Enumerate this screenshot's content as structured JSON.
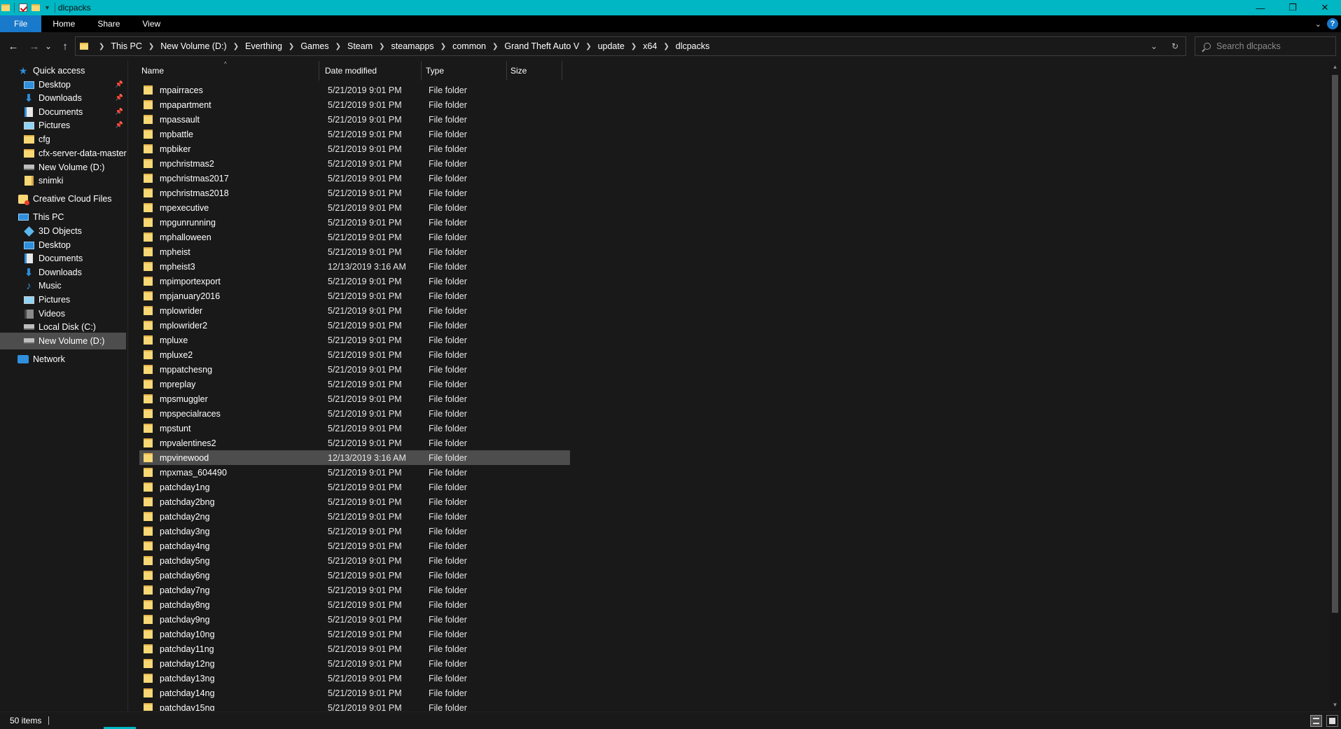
{
  "window": {
    "title": "dlcpacks",
    "controls": {
      "minimize": "—",
      "maximize": "❐",
      "close": "✕"
    }
  },
  "ribbon": {
    "tabs": [
      "File",
      "Home",
      "Share",
      "View"
    ],
    "help": "?"
  },
  "nav": {
    "back": "←",
    "forward": "→",
    "recent": "⌄",
    "up": "↑",
    "breadcrumbs": [
      "This PC",
      "New Volume (D:)",
      "Everthing",
      "Games",
      "Steam",
      "steamapps",
      "common",
      "Grand Theft Auto V",
      "update",
      "x64",
      "dlcpacks"
    ],
    "dropdown": "⌄",
    "refresh": "↻",
    "search_placeholder": "Search dlcpacks"
  },
  "sidebar": {
    "items": [
      {
        "label": "Quick access",
        "icon": "star-icon",
        "level": 0
      },
      {
        "label": "Desktop",
        "icon": "desktop-icon",
        "level": 1,
        "pinned": true
      },
      {
        "label": "Downloads",
        "icon": "download-icon",
        "level": 1,
        "pinned": true
      },
      {
        "label": "Documents",
        "icon": "document-icon",
        "level": 1,
        "pinned": true
      },
      {
        "label": "Pictures",
        "icon": "pictures-icon",
        "level": 1,
        "pinned": true
      },
      {
        "label": "cfg",
        "icon": "folder-icon",
        "level": 1
      },
      {
        "label": "cfx-server-data-master",
        "icon": "folder-icon",
        "level": 1
      },
      {
        "label": "New Volume (D:)",
        "icon": "drive-icon",
        "level": 1
      },
      {
        "label": "snimki",
        "icon": "folder-icon",
        "level": 1
      },
      {
        "label": "Creative Cloud Files",
        "icon": "creative-cloud-icon",
        "level": 0
      },
      {
        "label": "This PC",
        "icon": "computer-icon",
        "level": 0
      },
      {
        "label": "3D Objects",
        "icon": "3d-objects-icon",
        "level": 1
      },
      {
        "label": "Desktop",
        "icon": "desktop-icon",
        "level": 1
      },
      {
        "label": "Documents",
        "icon": "document-icon",
        "level": 1
      },
      {
        "label": "Downloads",
        "icon": "download-icon",
        "level": 1
      },
      {
        "label": "Music",
        "icon": "music-icon",
        "level": 1
      },
      {
        "label": "Pictures",
        "icon": "pictures-icon",
        "level": 1
      },
      {
        "label": "Videos",
        "icon": "videos-icon",
        "level": 1
      },
      {
        "label": "Local Disk (C:)",
        "icon": "drive-icon",
        "level": 1
      },
      {
        "label": "New Volume (D:)",
        "icon": "drive-icon",
        "level": 1,
        "selected": true
      },
      {
        "label": "Network",
        "icon": "network-icon",
        "level": 0
      }
    ]
  },
  "columns": {
    "name": "Name",
    "date": "Date modified",
    "type": "Type",
    "size": "Size"
  },
  "files": [
    {
      "name": "mpairraces",
      "date": "5/21/2019 9:01 PM",
      "type": "File folder"
    },
    {
      "name": "mpapartment",
      "date": "5/21/2019 9:01 PM",
      "type": "File folder"
    },
    {
      "name": "mpassault",
      "date": "5/21/2019 9:01 PM",
      "type": "File folder"
    },
    {
      "name": "mpbattle",
      "date": "5/21/2019 9:01 PM",
      "type": "File folder"
    },
    {
      "name": "mpbiker",
      "date": "5/21/2019 9:01 PM",
      "type": "File folder"
    },
    {
      "name": "mpchristmas2",
      "date": "5/21/2019 9:01 PM",
      "type": "File folder"
    },
    {
      "name": "mpchristmas2017",
      "date": "5/21/2019 9:01 PM",
      "type": "File folder"
    },
    {
      "name": "mpchristmas2018",
      "date": "5/21/2019 9:01 PM",
      "type": "File folder"
    },
    {
      "name": "mpexecutive",
      "date": "5/21/2019 9:01 PM",
      "type": "File folder"
    },
    {
      "name": "mpgunrunning",
      "date": "5/21/2019 9:01 PM",
      "type": "File folder"
    },
    {
      "name": "mphalloween",
      "date": "5/21/2019 9:01 PM",
      "type": "File folder"
    },
    {
      "name": "mpheist",
      "date": "5/21/2019 9:01 PM",
      "type": "File folder"
    },
    {
      "name": "mpheist3",
      "date": "12/13/2019 3:16 AM",
      "type": "File folder"
    },
    {
      "name": "mpimportexport",
      "date": "5/21/2019 9:01 PM",
      "type": "File folder"
    },
    {
      "name": "mpjanuary2016",
      "date": "5/21/2019 9:01 PM",
      "type": "File folder"
    },
    {
      "name": "mplowrider",
      "date": "5/21/2019 9:01 PM",
      "type": "File folder"
    },
    {
      "name": "mplowrider2",
      "date": "5/21/2019 9:01 PM",
      "type": "File folder"
    },
    {
      "name": "mpluxe",
      "date": "5/21/2019 9:01 PM",
      "type": "File folder"
    },
    {
      "name": "mpluxe2",
      "date": "5/21/2019 9:01 PM",
      "type": "File folder"
    },
    {
      "name": "mppatchesng",
      "date": "5/21/2019 9:01 PM",
      "type": "File folder"
    },
    {
      "name": "mpreplay",
      "date": "5/21/2019 9:01 PM",
      "type": "File folder"
    },
    {
      "name": "mpsmuggler",
      "date": "5/21/2019 9:01 PM",
      "type": "File folder"
    },
    {
      "name": "mpspecialraces",
      "date": "5/21/2019 9:01 PM",
      "type": "File folder"
    },
    {
      "name": "mpstunt",
      "date": "5/21/2019 9:01 PM",
      "type": "File folder"
    },
    {
      "name": "mpvalentines2",
      "date": "5/21/2019 9:01 PM",
      "type": "File folder"
    },
    {
      "name": "mpvinewood",
      "date": "12/13/2019 3:16 AM",
      "type": "File folder",
      "selected": true
    },
    {
      "name": "mpxmas_604490",
      "date": "5/21/2019 9:01 PM",
      "type": "File folder"
    },
    {
      "name": "patchday1ng",
      "date": "5/21/2019 9:01 PM",
      "type": "File folder"
    },
    {
      "name": "patchday2bng",
      "date": "5/21/2019 9:01 PM",
      "type": "File folder"
    },
    {
      "name": "patchday2ng",
      "date": "5/21/2019 9:01 PM",
      "type": "File folder"
    },
    {
      "name": "patchday3ng",
      "date": "5/21/2019 9:01 PM",
      "type": "File folder"
    },
    {
      "name": "patchday4ng",
      "date": "5/21/2019 9:01 PM",
      "type": "File folder"
    },
    {
      "name": "patchday5ng",
      "date": "5/21/2019 9:01 PM",
      "type": "File folder"
    },
    {
      "name": "patchday6ng",
      "date": "5/21/2019 9:01 PM",
      "type": "File folder"
    },
    {
      "name": "patchday7ng",
      "date": "5/21/2019 9:01 PM",
      "type": "File folder"
    },
    {
      "name": "patchday8ng",
      "date": "5/21/2019 9:01 PM",
      "type": "File folder"
    },
    {
      "name": "patchday9ng",
      "date": "5/21/2019 9:01 PM",
      "type": "File folder"
    },
    {
      "name": "patchday10ng",
      "date": "5/21/2019 9:01 PM",
      "type": "File folder"
    },
    {
      "name": "patchday11ng",
      "date": "5/21/2019 9:01 PM",
      "type": "File folder"
    },
    {
      "name": "patchday12ng",
      "date": "5/21/2019 9:01 PM",
      "type": "File folder"
    },
    {
      "name": "patchday13ng",
      "date": "5/21/2019 9:01 PM",
      "type": "File folder"
    },
    {
      "name": "patchday14ng",
      "date": "5/21/2019 9:01 PM",
      "type": "File folder"
    },
    {
      "name": "patchday15ng",
      "date": "5/21/2019 9:01 PM",
      "type": "File folder"
    }
  ],
  "status": {
    "count": "50 items"
  },
  "colors": {
    "titlebar": "#00b7c3",
    "file_tab": "#1979ca",
    "background": "#191919",
    "selection": "#4d4d4d",
    "folder": "#f8d775"
  }
}
